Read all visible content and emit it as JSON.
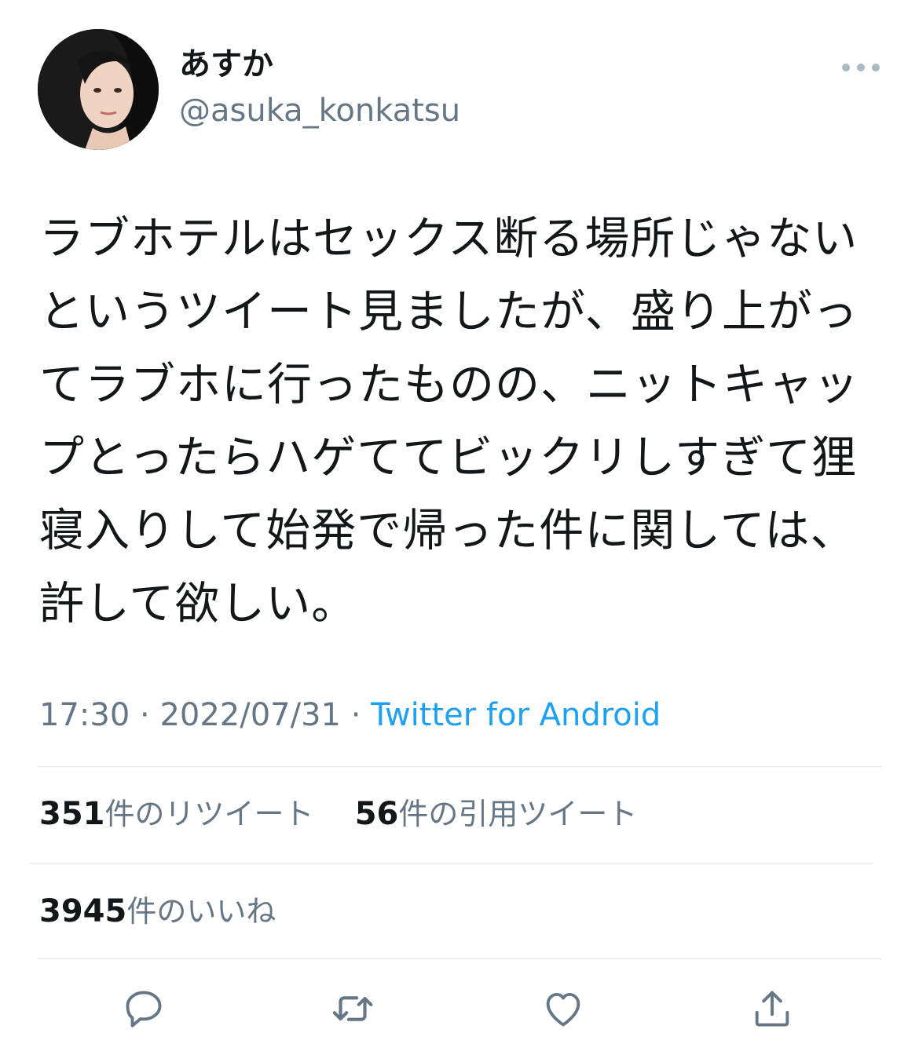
{
  "author": {
    "display_name": "あすか",
    "handle": "@asuka_konkatsu"
  },
  "tweet": {
    "text": "ラブホテルはセックス断る場所じゃないというツイート見ましたが、盛り上がってラブホに行ったものの、ニットキャップとったらハゲててビックリしすぎて狸寝入りして始発で帰った件に関しては、許して欲しい。",
    "time": "17:30",
    "separator": "·",
    "date": "2022/07/31",
    "source": "Twitter for Android"
  },
  "stats": {
    "retweets_count": "351",
    "retweets_label": "件のリツイート",
    "quotes_count": "56",
    "quotes_label": "件の引用ツイート",
    "likes_count": "3945",
    "likes_label": "件のいいね"
  },
  "actions": [
    "reply-icon",
    "retweet-icon",
    "like-icon",
    "share-icon"
  ],
  "colors": {
    "text": "#14171a",
    "secondary": "#657786",
    "link": "#1da1f2",
    "divider": "#e1e8ed"
  }
}
